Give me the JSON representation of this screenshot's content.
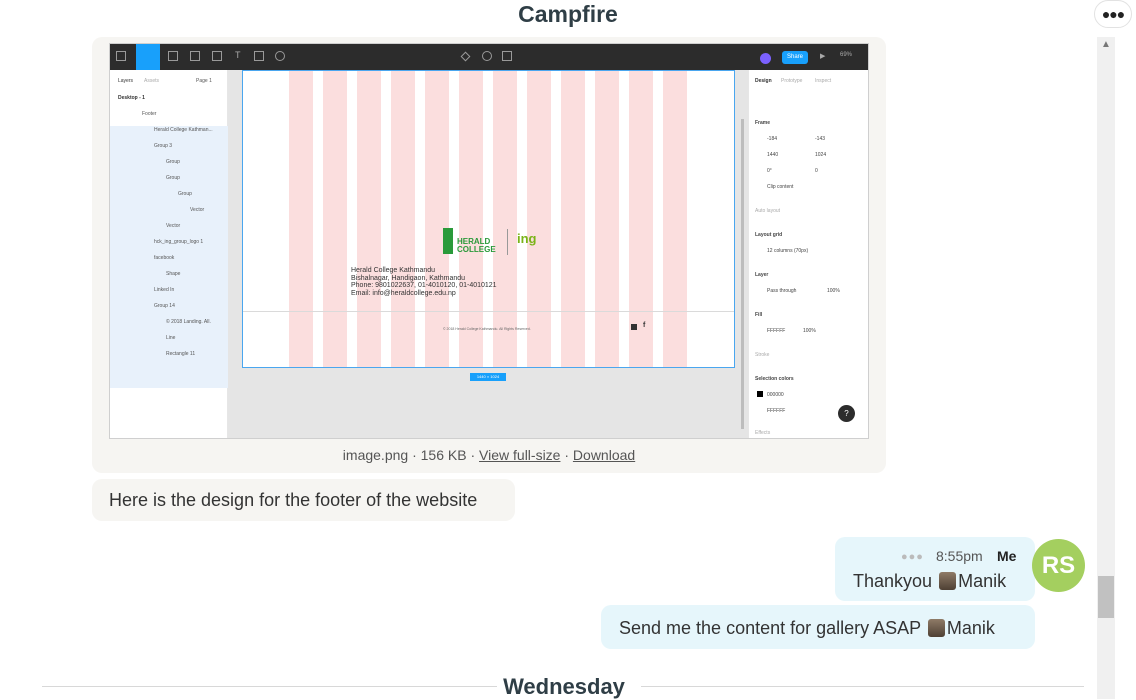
{
  "room": {
    "title": "Campfire"
  },
  "attachment": {
    "filename": "image.png",
    "size": "156 KB",
    "separator": "·",
    "view_label": "View full-size",
    "download_label": "Download",
    "figma": {
      "share_label": "Share",
      "zoom": "69%",
      "left_tabs": {
        "layers": "Layers",
        "assets": "Assets",
        "page": "Page 1"
      },
      "layers": [
        "Desktop - 1",
        "Footer",
        "Herald College Kathman...",
        "Group 3",
        "Group",
        "Group",
        "Group",
        "Vector",
        "Vector",
        "hck_ing_group_logo 1",
        "facebook",
        "Shape",
        "Linked In",
        "Group 14",
        "© 2018 Landing. All.",
        "Line",
        "Rectangle 11"
      ],
      "right_tabs": {
        "design": "Design",
        "prototype": "Prototype",
        "inspect": "Inspect"
      },
      "frame_label": "Frame",
      "x": "-184",
      "y": "-143",
      "w": "1440",
      "h": "1024",
      "rotation": "0°",
      "radius": "0",
      "clip_label": "Clip content",
      "auto_layout": "Auto layout",
      "layout_grid": "Layout grid",
      "grid_desc": "12 columns (70px)",
      "layer_label": "Layer",
      "pass_through": "Pass through",
      "opacity": "100%",
      "fill_label": "Fill",
      "fill_hex": "FFFFFF",
      "fill_opacity": "100%",
      "stroke_label": "Stroke",
      "selection_colors": "Selection colors",
      "sel_color1": "000000",
      "sel_color2": "FFFFFF",
      "effects": "Effects",
      "size_badge": "1440 × 1024",
      "logo_line1": "HERALD",
      "logo_line2": "COLLEGE",
      "logo_ing": "ing",
      "address": [
        "Herald College Kathmandu",
        "Bishalnagar, Handigaon, Kathmandu",
        "Phone: 9801022637, 01-4010120, 01-4010121",
        "Email: info@heraldcollege.edu.np"
      ],
      "copyright": "© 2018 Herald College Kathmandu. All Rights Reserved."
    }
  },
  "messages": {
    "m1": "Here is the design for the footer of the website",
    "m2_time": "8:55pm",
    "m2_sender": "Me",
    "m2_text": "Thankyou",
    "m2_mention": "Manik",
    "m3_text": "Send me the content for gallery ASAP",
    "m3_mention": "Manik"
  },
  "avatar": {
    "initials": "RS",
    "color": "#a4cf5f"
  },
  "day_separator": "Wednesday",
  "colors": {
    "figma_blue": "#18a0fb",
    "grid_pink": "#fbdede",
    "bubble_me": "#e6f6fb",
    "bubble_other": "#f6f5f2"
  }
}
